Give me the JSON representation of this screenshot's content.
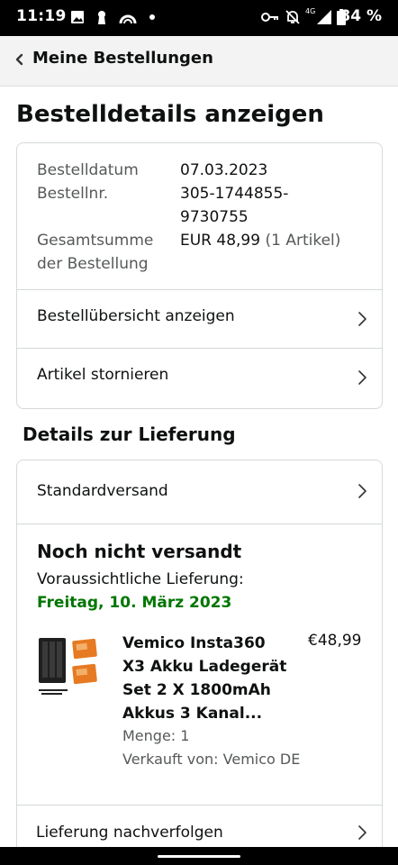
{
  "status_bar": {
    "time": "11:19",
    "battery_text": "84 %",
    "network_label": "4G",
    "left_icons": [
      "image-icon",
      "keyhole-icon",
      "app-notification-icon",
      "dot-icon"
    ],
    "right_icons": [
      "vpn-key-icon",
      "mute-bell-icon",
      "network-4g-icon",
      "signal-icon",
      "battery-icon"
    ]
  },
  "header": {
    "back_label": "Meine Bestellungen"
  },
  "page": {
    "title": "Bestelldetails anzeigen"
  },
  "order_info": {
    "date_label": "Bestelldatum",
    "date_value": "07.03.2023",
    "number_label": "Bestellnr.",
    "number_value_line1": "305-1744855-",
    "number_value_line2": "9730755",
    "total_label_line1": "Gesamtsumme",
    "total_label_line2": "der Bestellung",
    "total_value": "EUR 48,99",
    "total_items": "(1 Artikel)"
  },
  "order_actions": [
    {
      "label": "Bestellübersicht anzeigen"
    },
    {
      "label": "Artikel stornieren"
    }
  ],
  "delivery": {
    "section_title": "Details zur Lieferung",
    "shipping_method": "Standardversand",
    "status": "Noch nicht versandt",
    "eta_label": "Voraussichtliche Lieferung:",
    "eta_date": "Freitag, 10. März 2023",
    "item": {
      "name_lines": [
        "Vemico Insta360",
        "X3 Akku Ladegerät",
        "Set 2 X 1800mAh",
        "Akkus 3 Kanal..."
      ],
      "price": "€48,99",
      "quantity": "Menge: 1",
      "seller": "Verkauft von: Vemico DE"
    },
    "track_label": "Lieferung nachverfolgen"
  },
  "colors": {
    "eta_green": "#007600",
    "border": "#d5d9d9",
    "muted_text": "#565959",
    "header_bg": "#f3f3f3"
  }
}
